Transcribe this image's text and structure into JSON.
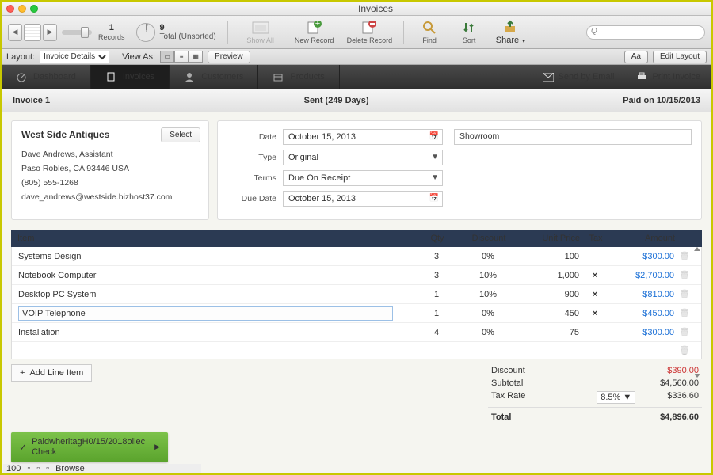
{
  "window": {
    "title": "Invoices"
  },
  "records": {
    "current": "1",
    "total": "9",
    "total_label": "Total (Unsorted)",
    "records_label": "Records"
  },
  "toolbar": {
    "show_all": "Show All",
    "new_record": "New Record",
    "delete_record": "Delete Record",
    "find": "Find",
    "sort": "Sort",
    "share": "Share",
    "search_placeholder": ""
  },
  "layoutbar": {
    "layout_label": "Layout:",
    "layout_value": "Invoice Details",
    "viewas_label": "View As:",
    "preview": "Preview",
    "aa": "Aa",
    "edit_layout": "Edit Layout"
  },
  "nav": {
    "dashboard": "Dashboard",
    "invoices": "Invoices",
    "customers": "Customers",
    "products": "Products",
    "send_email": "Send by Email",
    "print": "Print Invoice"
  },
  "status": {
    "left": "Invoice 1",
    "center": "Sent (249 Days)",
    "right": "Paid on 10/15/2013"
  },
  "customer": {
    "name": "West Side Antiques",
    "select": "Select",
    "contact": "Dave Andrews, Assistant",
    "address": "Paso Robles, CA 93446 USA",
    "phone": "(805) 555-1268",
    "email": "dave_andrews@westside.bizhost37.com"
  },
  "meta": {
    "date_k": "Date",
    "date_v": "October 15, 2013",
    "type_k": "Type",
    "type_v": "Original",
    "terms_k": "Terms",
    "terms_v": "Due On Receipt",
    "due_k": "Due Date",
    "due_v": "October 15, 2013",
    "location": "Showroom"
  },
  "table": {
    "h_item": "Item",
    "h_qty": "Qty",
    "h_disc": "Discount",
    "h_unit": "Unit Price",
    "h_tax": "Tax",
    "h_amt": "Amount"
  },
  "items": [
    {
      "name": "Systems Design",
      "qty": "3",
      "disc": "0%",
      "unit": "100",
      "tax": "",
      "amt": "$300.00"
    },
    {
      "name": "Notebook Computer",
      "qty": "3",
      "disc": "10%",
      "unit": "1,000",
      "tax": "×",
      "amt": "$2,700.00"
    },
    {
      "name": "Desktop PC System",
      "qty": "1",
      "disc": "10%",
      "unit": "900",
      "tax": "×",
      "amt": "$810.00"
    },
    {
      "name": "VOIP Telephone",
      "qty": "1",
      "disc": "0%",
      "unit": "450",
      "tax": "×",
      "amt": "$450.00"
    },
    {
      "name": "Installation",
      "qty": "4",
      "disc": "0%",
      "unit": "75",
      "tax": "",
      "amt": "$300.00"
    }
  ],
  "add_line": "Add Line Item",
  "totals": {
    "discount_k": "Discount",
    "discount_v": "$390.00",
    "subtotal_k": "Subtotal",
    "subtotal_v": "$4,560.00",
    "taxrate_k": "Tax Rate",
    "taxrate_mid": "8.5%",
    "taxrate_v": "$336.60",
    "total_k": "Total",
    "total_v": "$4,896.60"
  },
  "paid_badge": {
    "line1": "PaidwheritagH0/15/2018ollec",
    "line2": "Check"
  },
  "bottom": {
    "pos": "100",
    "mode": "Browse"
  }
}
